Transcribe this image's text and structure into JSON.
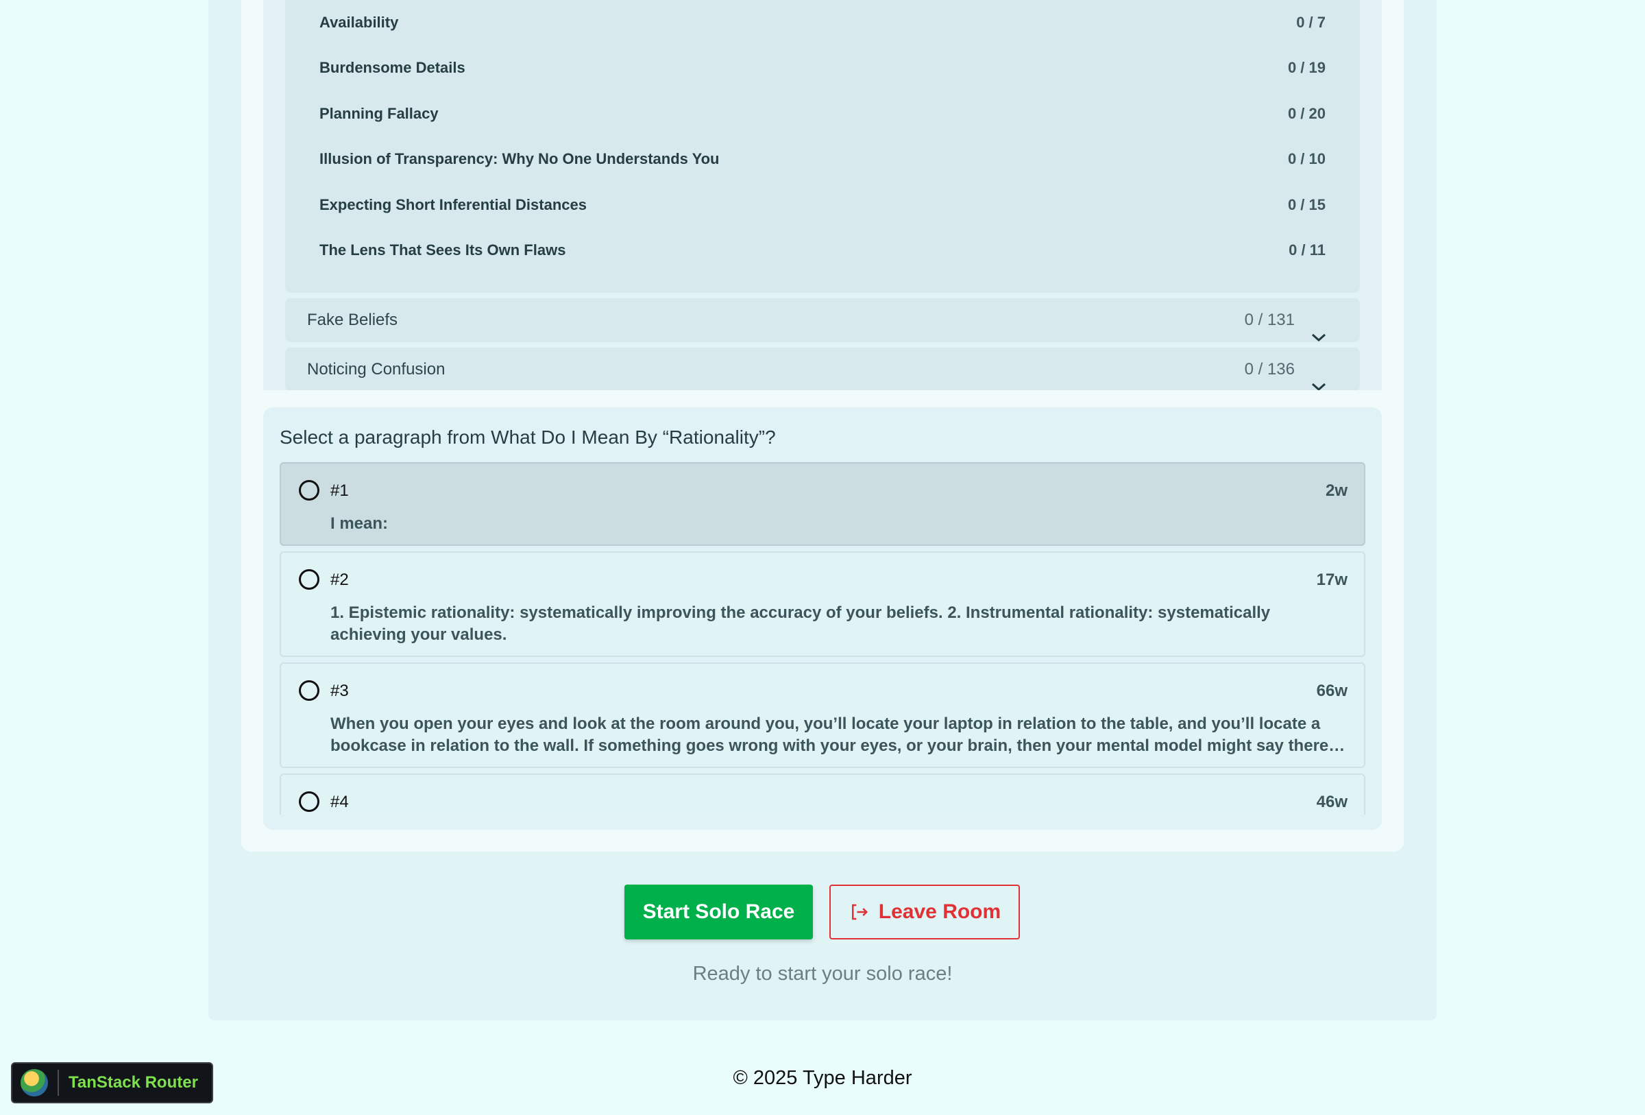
{
  "chapters": {
    "expanded_items": [
      {
        "title": "Availability",
        "count": "0 / 7"
      },
      {
        "title": "Burdensome Details",
        "count": "0 / 19"
      },
      {
        "title": "Planning Fallacy",
        "count": "0 / 20"
      },
      {
        "title": "Illusion of Transparency: Why No One Understands You",
        "count": "0 / 10"
      },
      {
        "title": "Expecting Short Inferential Distances",
        "count": "0 / 15"
      },
      {
        "title": "The Lens That Sees Its Own Flaws",
        "count": "0 / 11"
      }
    ],
    "collapsed_items": [
      {
        "title": "Fake Beliefs",
        "count": "0 / 131"
      },
      {
        "title": "Noticing Confusion",
        "count": "0 / 136"
      }
    ]
  },
  "paragraphs": {
    "prompt": "Select a paragraph from What Do I Mean By “Rationality”?",
    "items": [
      {
        "num": "#1",
        "words": "2w",
        "text": "I mean:"
      },
      {
        "num": "#2",
        "words": "17w",
        "text": "1. Epistemic rationality: systematically improving the accuracy of your beliefs. 2. Instrumental rationality: systematically achieving your values."
      },
      {
        "num": "#3",
        "words": "66w",
        "text": "When you open your eyes and look at the room around you, you’ll locate your laptop in relation to the table, and you’ll locate a bookcase in relation to the wall. If something goes wrong with your eyes, or your brain, then your mental model might say there…"
      },
      {
        "num": "#4",
        "words": "46w",
        "text": ""
      }
    ]
  },
  "actions": {
    "start_label": "Start Solo Race",
    "leave_label": "Leave Room"
  },
  "status": "Ready to start your solo race!",
  "footer": "© 2025 Type Harder",
  "devtools": {
    "label": "TanStack Router"
  },
  "colors": {
    "accent_green": "#00b04a",
    "danger_red": "#e03236",
    "background": "#eafdfd"
  }
}
